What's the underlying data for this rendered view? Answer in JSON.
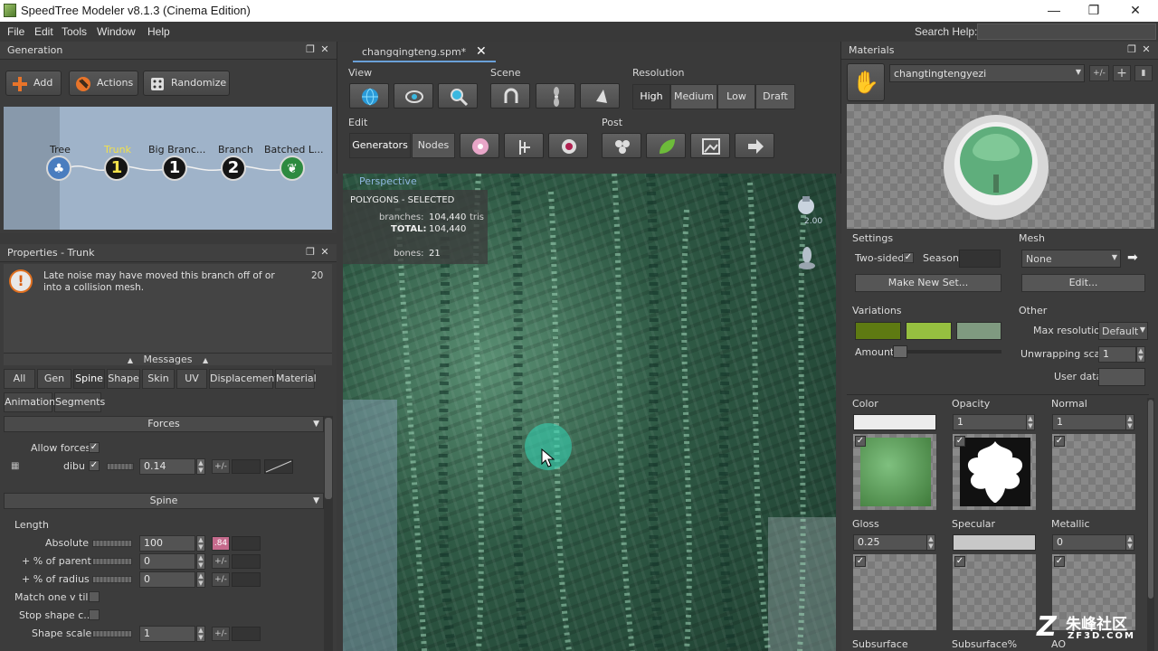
{
  "window": {
    "title": "SpeedTree Modeler v8.1.3 (Cinema Edition)",
    "minimize": "—",
    "maximize": "❐",
    "close": "✕"
  },
  "menu": [
    "File",
    "Edit",
    "Tools",
    "Window",
    "Help"
  ],
  "search": {
    "label": "Search Help:",
    "value": ""
  },
  "generation": {
    "title": "Generation",
    "buttons": {
      "add": "Add",
      "actions": "Actions",
      "randomize": "Randomize"
    },
    "nodes": [
      {
        "label": "Tree",
        "value": ""
      },
      {
        "label": "Trunk",
        "value": "1"
      },
      {
        "label": "Big Branc...",
        "value": "1"
      },
      {
        "label": "Branch",
        "value": "2"
      },
      {
        "label": "Batched L...",
        "value": ""
      }
    ]
  },
  "properties": {
    "title": "Properties - Trunk",
    "message": "Late noise may have moved this branch off of or into a collision mesh.",
    "message_count": "20",
    "messages_label": "Messages",
    "tabs_row1": [
      "All",
      "Gen",
      "Spine",
      "Shape",
      "Skin",
      "UV",
      "Displacement",
      "Material"
    ],
    "tabs_row2": [
      "Animation",
      "Segments"
    ],
    "forces": {
      "header": "Forces",
      "allow_label": "Allow forces",
      "force_name": "dibu",
      "force_value": "0.14",
      "pm": "+/-"
    },
    "spine": {
      "header": "Spine",
      "group": "Length",
      "rows": [
        {
          "label": "Absolute",
          "value": "100",
          "extra": ".84"
        },
        {
          "label": "+ % of parent",
          "value": "0",
          "extra": "+/-"
        },
        {
          "label": "+ % of radius",
          "value": "0",
          "extra": "+/-"
        }
      ],
      "match_label": "Match one v tile",
      "stop_label": "Stop shape c...",
      "shape_scale_label": "Shape scale",
      "shape_scale_value": "1",
      "pm": "+/-"
    }
  },
  "document_tab": {
    "name": "changqingteng.spm*",
    "close": "✕"
  },
  "toolbar": {
    "view_label": "View",
    "scene_label": "Scene",
    "resolution_label": "Resolution",
    "resolution_options": [
      "High",
      "Medium",
      "Low",
      "Draft"
    ],
    "edit_label": "Edit",
    "edit_modes": [
      "Generators",
      "Nodes"
    ],
    "post_label": "Post"
  },
  "viewport": {
    "camera_label": "Perspective",
    "stats_title": "POLYGONS - SELECTED",
    "branches_label": "branches:",
    "branches_value": "104,440",
    "branches_unit": "tris",
    "total_label": "TOTAL:",
    "total_value": "104,440",
    "bones_label": "bones:",
    "bones_value": "21",
    "scale_label": "2.00"
  },
  "materials": {
    "title": "Materials",
    "material_name": "changtingtengyezi",
    "pm": "+/-",
    "settings_label": "Settings",
    "two_sided_label": "Two-sided",
    "season_label": "Season",
    "make_new_set": "Make New Set...",
    "mesh_label": "Mesh",
    "mesh_value": "None",
    "edit_button": "Edit...",
    "variations_label": "Variations",
    "amount_label": "Amount",
    "other_label": "Other",
    "max_res_label": "Max resolution",
    "max_res_value": "Default",
    "unwrap_label": "Unwrapping scale",
    "unwrap_value": "1",
    "user_data_label": "User data",
    "maps": [
      {
        "label": "Color",
        "value": ""
      },
      {
        "label": "Opacity",
        "value": "1"
      },
      {
        "label": "Normal",
        "value": "1"
      },
      {
        "label": "Gloss",
        "value": "0.25"
      },
      {
        "label": "Specular",
        "value": ""
      },
      {
        "label": "Metallic",
        "value": "0"
      }
    ],
    "bottom_labels": [
      "Subsurface",
      "Subsurface%",
      "AO"
    ],
    "variation_colors": [
      "#5e7a12",
      "#96c040",
      "#7f9a80"
    ]
  },
  "watermark": {
    "logo": "Z",
    "text": "朱峰社区",
    "url": "ZF3D.COM"
  }
}
